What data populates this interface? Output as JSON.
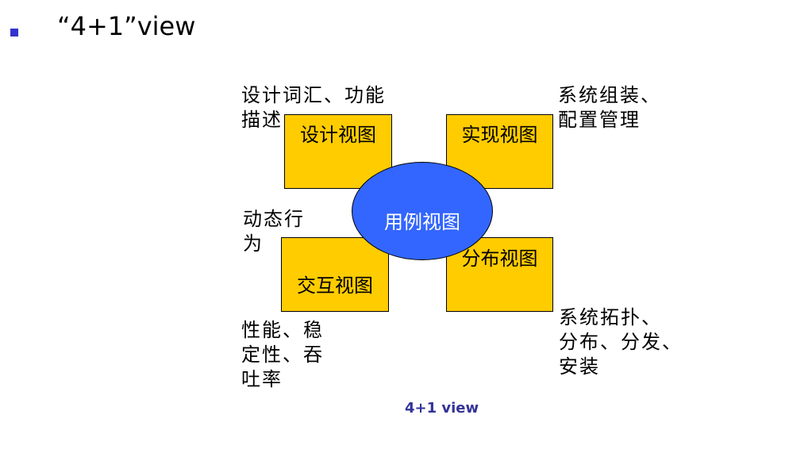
{
  "slide": {
    "title": "“4+1”view",
    "bullet_color": "#3333cc"
  },
  "diagram": {
    "center": {
      "label": "用例视图",
      "color": "#3366ff"
    },
    "views": {
      "design": "设计视图",
      "implementation": "实现视图",
      "interaction": "交互视图",
      "deployment": "分布视图"
    },
    "box_color": "#ffcc00",
    "notes": {
      "design": [
        "设计词汇、功能",
        "描述"
      ],
      "implementation": [
        "系统组装、",
        "配置管理"
      ],
      "behavior": [
        "动态行",
        "为"
      ],
      "performance": [
        "性能、稳",
        "定性、吞",
        "吐率"
      ],
      "topology": [
        "系统拓扑、",
        "分布、分发、",
        "安装"
      ]
    },
    "caption": "4+1 view"
  }
}
